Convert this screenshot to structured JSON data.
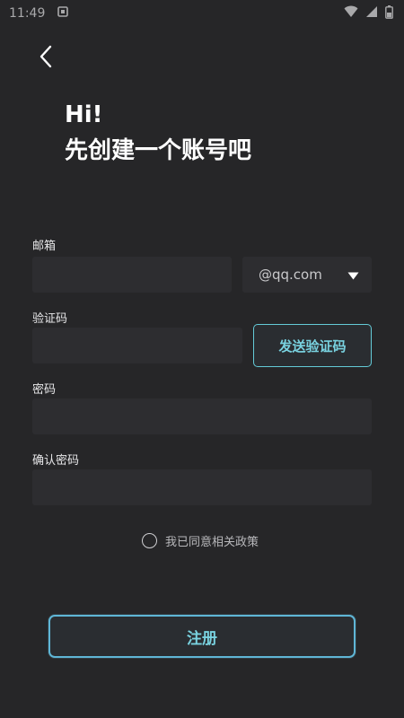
{
  "status_bar": {
    "time": "11:49"
  },
  "header": {
    "greeting_line1": "Hi!",
    "greeting_line2": "先创建一个账号吧"
  },
  "form": {
    "email_label": "邮箱",
    "email_value": "",
    "email_domain": "@qq.com",
    "code_label": "验证码",
    "code_value": "",
    "send_code_label": "发送验证码",
    "password_label": "密码",
    "password_value": "",
    "confirm_password_label": "确认密码",
    "confirm_password_value": "",
    "agree_label": "我已同意相关政策",
    "register_label": "注册"
  },
  "colors": {
    "background": "#262628",
    "input_background": "#2d2d30",
    "accent": "#79d2e0",
    "text": "#ffffff"
  },
  "icons": {
    "back": "chevron-left-icon",
    "dropdown": "caret-down-icon",
    "wifi": "wifi-icon",
    "cellular": "cellular-signal-icon",
    "battery": "battery-icon"
  }
}
